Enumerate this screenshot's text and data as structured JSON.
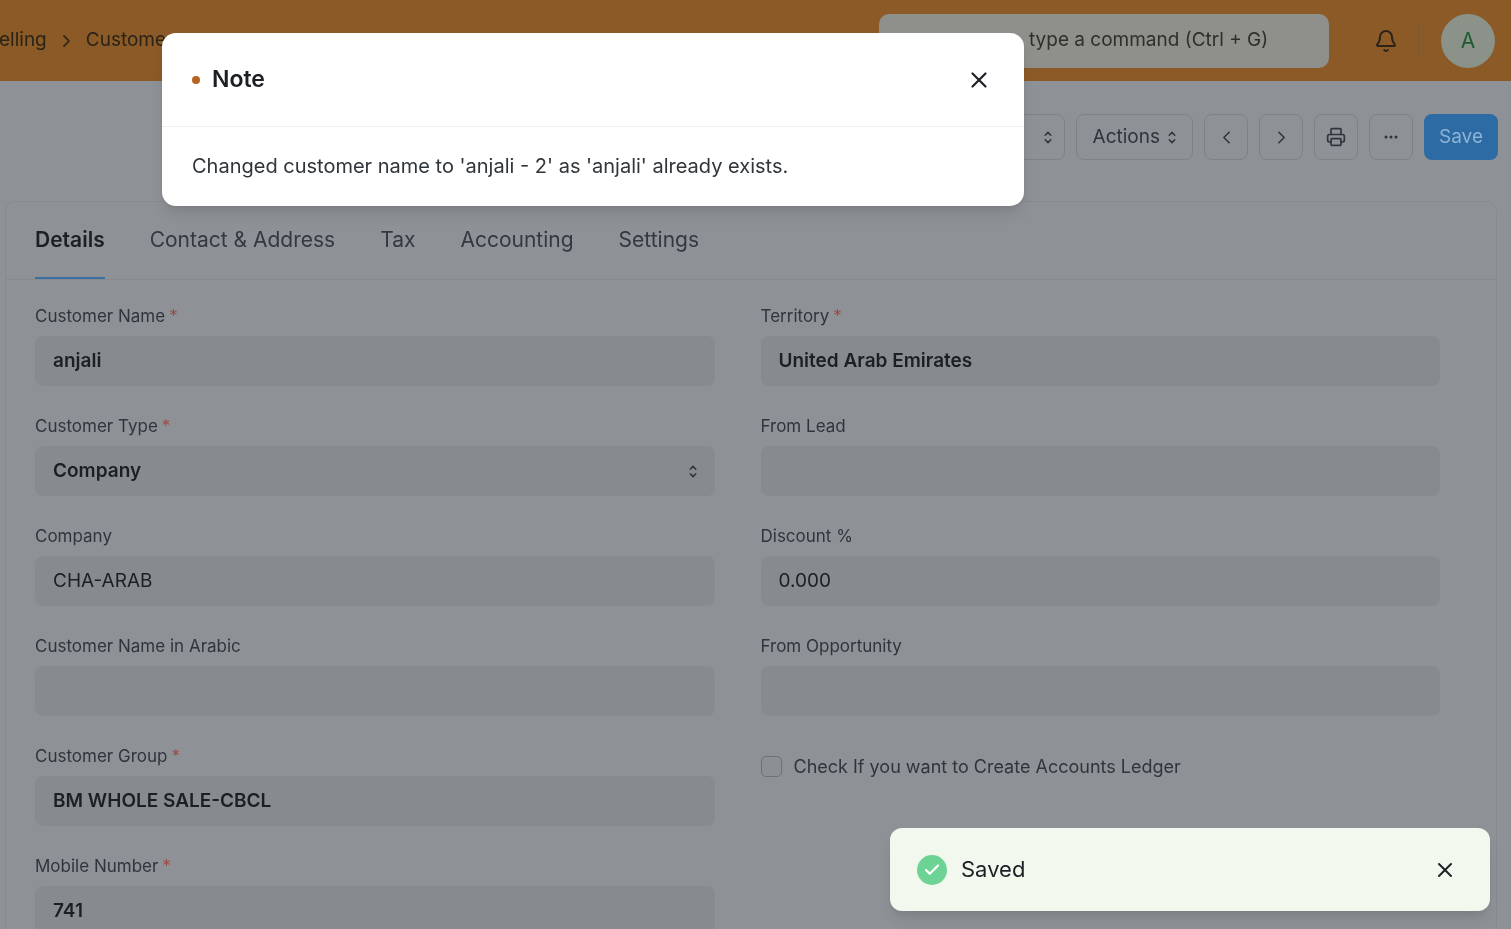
{
  "breadcrumbs": [
    "elling",
    "Custome"
  ],
  "search": {
    "placeholder": "type a command (Ctrl + G)"
  },
  "avatar": "A",
  "toolbar": {
    "actions": "Actions",
    "save": "Save"
  },
  "tabs": [
    {
      "label": "Details",
      "selected": true
    },
    {
      "label": "Contact & Address",
      "selected": false
    },
    {
      "label": "Tax",
      "selected": false
    },
    {
      "label": "Accounting",
      "selected": false
    },
    {
      "label": "Settings",
      "selected": false
    }
  ],
  "left_fields": [
    {
      "label": "Customer Name",
      "required_mark": "*",
      "value": "anjali",
      "kind": "text",
      "bold": true
    },
    {
      "label": "Customer Type",
      "required_mark": "*",
      "value": "Company",
      "kind": "select",
      "bold": true
    },
    {
      "label": "Company",
      "value": "CHA-ARAB",
      "kind": "text",
      "bold": false
    },
    {
      "label": "Customer Name in Arabic",
      "kind": "text"
    },
    {
      "label": "Customer Group",
      "required_mark": "*",
      "value": "BM WHOLE SALE-CBCL",
      "kind": "text",
      "bold": true
    },
    {
      "label": "Mobile Number",
      "required_mark": "*",
      "value": "741",
      "kind": "text",
      "bold": true
    }
  ],
  "right_fields": [
    {
      "label": "Territory",
      "required_mark": "*",
      "value": "United Arab Emirates",
      "kind": "text",
      "bold": true
    },
    {
      "label": "From Lead",
      "kind": "text"
    },
    {
      "label": "Discount %",
      "value": "0.000",
      "kind": "text",
      "bold": false
    },
    {
      "label": "From Opportunity",
      "kind": "text"
    },
    {
      "label": "Check If you want to Create Accounts Ledger",
      "kind": "checkbox",
      "checked": false
    }
  ],
  "dialog": {
    "title": "Note",
    "message": "Changed customer name to 'anjali - 2' as 'anjali' already exists."
  },
  "toast": {
    "message": "Saved"
  }
}
